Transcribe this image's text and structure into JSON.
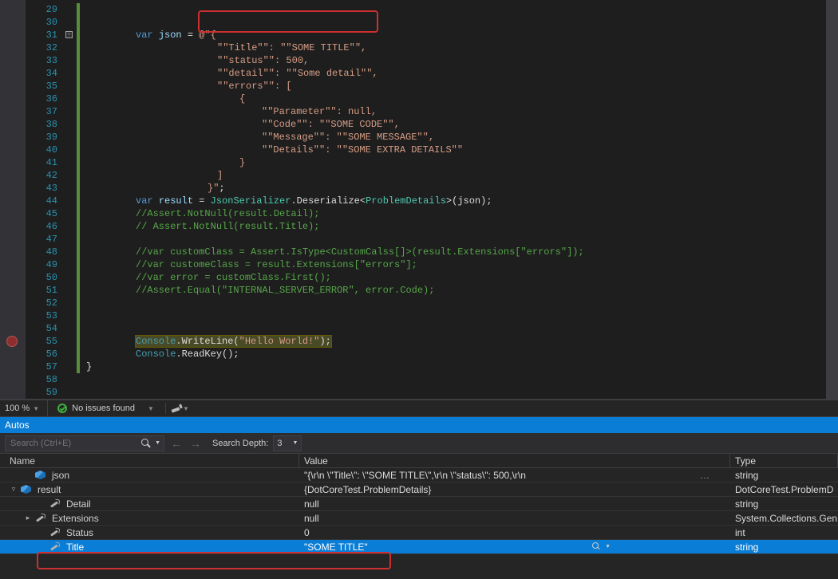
{
  "editor": {
    "first_line": 29,
    "last_line": 59,
    "breakpoint_line": 55,
    "fold_line": 31,
    "highlight_box_lines": [
      31,
      32
    ],
    "lines": [
      {
        "n": 29,
        "ind": 12,
        "segs": []
      },
      {
        "n": 30,
        "ind": 12,
        "segs": []
      },
      {
        "n": 31,
        "ind": 12,
        "segs": [
          {
            "c": "tok-kw",
            "t": "var"
          },
          {
            "c": "tok-wh",
            "t": " "
          },
          {
            "c": "tok-var",
            "t": "json"
          },
          {
            "c": "tok-wh",
            "t": " = "
          },
          {
            "c": "tok-str",
            "t": "@\"{"
          }
        ]
      },
      {
        "n": 32,
        "ind": 18,
        "segs": [
          {
            "c": "tok-str",
            "t": "\"\"Title\"\": \"\"SOME TITLE\"\","
          }
        ]
      },
      {
        "n": 33,
        "ind": 18,
        "segs": [
          {
            "c": "tok-str",
            "t": "\"\"status\"\": 500,"
          }
        ]
      },
      {
        "n": 34,
        "ind": 18,
        "segs": [
          {
            "c": "tok-str",
            "t": "\"\"detail\"\": \"\"Some detail\"\","
          }
        ]
      },
      {
        "n": 35,
        "ind": 18,
        "segs": [
          {
            "c": "tok-str",
            "t": "\"\"errors\"\": ["
          }
        ]
      },
      {
        "n": 36,
        "ind": 20,
        "segs": [
          {
            "c": "tok-str",
            "t": "{"
          }
        ]
      },
      {
        "n": 37,
        "ind": 22,
        "segs": [
          {
            "c": "tok-str",
            "t": "\"\"Parameter\"\": null,"
          }
        ]
      },
      {
        "n": 38,
        "ind": 22,
        "segs": [
          {
            "c": "tok-str",
            "t": "\"\"Code\"\": \"\"SOME CODE\"\","
          }
        ]
      },
      {
        "n": 39,
        "ind": 22,
        "segs": [
          {
            "c": "tok-str",
            "t": "\"\"Message\"\": \"\"SOME MESSAGE\"\","
          }
        ]
      },
      {
        "n": 40,
        "ind": 22,
        "segs": [
          {
            "c": "tok-str",
            "t": "\"\"Details\"\": \"\"SOME EXTRA DETAILS\"\""
          }
        ]
      },
      {
        "n": 41,
        "ind": 20,
        "segs": [
          {
            "c": "tok-str",
            "t": "}"
          }
        ]
      },
      {
        "n": 42,
        "ind": 18,
        "segs": [
          {
            "c": "tok-str",
            "t": "]"
          }
        ]
      },
      {
        "n": 43,
        "ind": 16,
        "segs": [
          {
            "c": "tok-str",
            "t": "}\""
          },
          {
            "c": "tok-wh",
            "t": ";"
          }
        ]
      },
      {
        "n": 44,
        "ind": 12,
        "segs": [
          {
            "c": "tok-kw",
            "t": "var"
          },
          {
            "c": "tok-wh",
            "t": " "
          },
          {
            "c": "tok-var",
            "t": "result"
          },
          {
            "c": "tok-wh",
            "t": " = "
          },
          {
            "c": "tok-type",
            "t": "JsonSerializer"
          },
          {
            "c": "tok-wh",
            "t": ".Deserialize<"
          },
          {
            "c": "tok-type",
            "t": "ProblemDetails"
          },
          {
            "c": "tok-wh",
            "t": ">(json);"
          }
        ]
      },
      {
        "n": 45,
        "ind": 12,
        "segs": [
          {
            "c": "tok-com",
            "t": "//Assert.NotNull(result.Detail);"
          }
        ]
      },
      {
        "n": 46,
        "ind": 12,
        "segs": [
          {
            "c": "tok-com",
            "t": "// Assert.NotNull(result.Title);"
          }
        ]
      },
      {
        "n": 47,
        "ind": 12,
        "segs": []
      },
      {
        "n": 48,
        "ind": 12,
        "segs": [
          {
            "c": "tok-com",
            "t": "//var customClass = Assert.IsType<CustomCalss[]>(result.Extensions[\"errors\"]);"
          }
        ]
      },
      {
        "n": 49,
        "ind": 12,
        "segs": [
          {
            "c": "tok-com",
            "t": "//var customeClass = result.Extensions[\"errors\"];"
          }
        ]
      },
      {
        "n": 50,
        "ind": 12,
        "segs": [
          {
            "c": "tok-com",
            "t": "//var error = customClass.First();"
          }
        ]
      },
      {
        "n": 51,
        "ind": 12,
        "segs": [
          {
            "c": "tok-com",
            "t": "//Assert.Equal(\"INTERNAL_SERVER_ERROR\", error.Code);"
          }
        ]
      },
      {
        "n": 52,
        "ind": 12,
        "segs": []
      },
      {
        "n": 53,
        "ind": 12,
        "segs": []
      },
      {
        "n": 54,
        "ind": 12,
        "segs": []
      },
      {
        "n": 55,
        "ind": 12,
        "hl": true,
        "segs": [
          {
            "c": "tok-cls",
            "t": "Console"
          },
          {
            "c": "tok-wh",
            "t": ".WriteLine("
          },
          {
            "c": "tok-str",
            "t": "\"Hello World!\""
          },
          {
            "c": "tok-wh",
            "t": ");"
          }
        ]
      },
      {
        "n": 56,
        "ind": 12,
        "segs": [
          {
            "c": "tok-cls",
            "t": "Console"
          },
          {
            "c": "tok-wh",
            "t": ".ReadKey();"
          }
        ]
      },
      {
        "n": 57,
        "ind": 8,
        "segs": [
          {
            "c": "tok-wh",
            "t": "}"
          }
        ]
      },
      {
        "n": 58,
        "ind": 8,
        "segs": []
      },
      {
        "n": 59,
        "ind": 8,
        "segs": []
      }
    ]
  },
  "status": {
    "zoom": "100 %",
    "issues": "No issues found"
  },
  "autos": {
    "tab_label": "Autos",
    "search_placeholder": "Search (Ctrl+E)",
    "depth_label": "Search Depth:",
    "depth_value": "3",
    "columns": {
      "name": "Name",
      "value": "Value",
      "type": "Type"
    },
    "rows": [
      {
        "tw": "",
        "indent": 1,
        "icon": "cube",
        "name": "json",
        "value": "\"{\\r\\n                    \\\"Title\\\": \\\"SOME TITLE\\\",\\r\\n                    \\\"status\\\": 500,\\r\\n",
        "type": "string",
        "glyph": "dots"
      },
      {
        "tw": "▿",
        "indent": 0,
        "icon": "cube",
        "name": "result",
        "value": "{DotCoreTest.ProblemDetails}",
        "type": "DotCoreTest.ProblemD"
      },
      {
        "tw": "",
        "indent": 2,
        "icon": "wrench",
        "name": "Detail",
        "value": "null",
        "type": "string"
      },
      {
        "tw": "▸",
        "indent": 1,
        "icon": "wrench",
        "name": "Extensions",
        "value": "null",
        "type": "System.Collections.Gen"
      },
      {
        "tw": "",
        "indent": 2,
        "icon": "wrench",
        "name": "Status",
        "value": "0",
        "type": "int"
      },
      {
        "tw": "",
        "indent": 2,
        "icon": "wrench",
        "name": "Title",
        "value": "\"SOME TITLE\"",
        "type": "string",
        "selected": true,
        "glyph": "mag"
      }
    ]
  }
}
